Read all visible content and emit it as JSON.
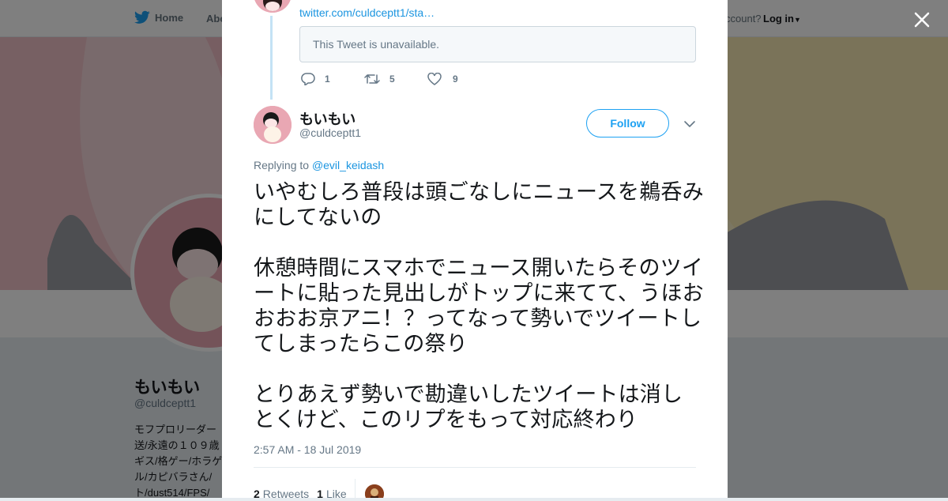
{
  "nav": {
    "home_label": "Home",
    "about_label": "Abo",
    "account_text": "ccount?",
    "login_label": "Log in"
  },
  "profile": {
    "name": "もいもい",
    "handle": "@culdceptt1",
    "bio_lines": [
      "モフプロリーダー",
      "送/永遠の１０９歳",
      "ギス/格ゲー/ホラゲ",
      "ル/カピバラさん/",
      "ト/dust514/FPS/"
    ]
  },
  "previous_tweet": {
    "link_text": "twitter.com/culdceptt1/sta…",
    "unavailable_text": "This Tweet is unavailable.",
    "reply_count": "1",
    "retweet_count": "5",
    "like_count": "9"
  },
  "tweet": {
    "author_name": "もいもい",
    "author_handle": "@culdceptt1",
    "follow_label": "Follow",
    "replying_to_prefix": "Replying to",
    "replying_to_handle": "@evil_keidash",
    "text_paragraphs": [
      "いやむしろ普段は頭ごなしにニュースを鵜呑みにしてないの",
      "休憩時間にスマホでニュース開いたらそのツイートに貼った見出しがトップに来てて、うほおおおお京アニ！？ってなって勢いでツイートしてしまったらこの祭り",
      "とりあえず勢いで勘違いしたツイートは消しとくけど、このリプをもって対応終わり"
    ],
    "timestamp": "2:57 AM - 18 Jul 2019",
    "retweets_count": "2",
    "retweets_label": "Retweets",
    "likes_count": "1",
    "likes_label": "Like"
  },
  "colors": {
    "accent": "#1da1f2",
    "link": "#1b95e0",
    "thread_line": "#c4e2f5"
  }
}
